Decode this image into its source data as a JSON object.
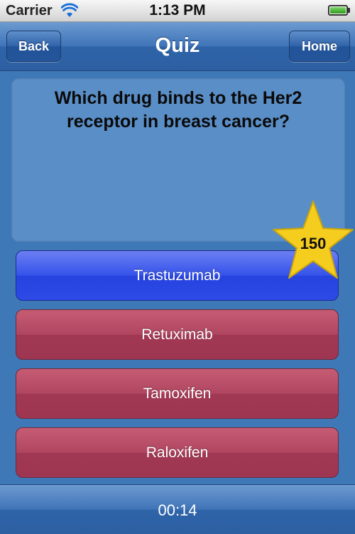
{
  "status_bar": {
    "carrier": "Carrier",
    "time": "1:13 PM"
  },
  "nav": {
    "title": "Quiz",
    "back_label": "Back",
    "home_label": "Home"
  },
  "question": {
    "text": "Which drug binds to the Her2 receptor in breast cancer?"
  },
  "answers": [
    {
      "label": "Trastuzumab",
      "state": "correct"
    },
    {
      "label": "Retuximab",
      "state": "incorrect"
    },
    {
      "label": "Tamoxifen",
      "state": "incorrect"
    },
    {
      "label": "Raloxifen",
      "state": "incorrect"
    }
  ],
  "score_star": {
    "points": "150"
  },
  "footer": {
    "timer": "00:14"
  },
  "colors": {
    "background": "#3f78b6",
    "correct_answer": "#2d4ae6",
    "wrong_answer": "#a13853",
    "star": "#f5cd1e"
  },
  "icons": [
    "wifi-icon",
    "battery-icon",
    "star-icon"
  ]
}
